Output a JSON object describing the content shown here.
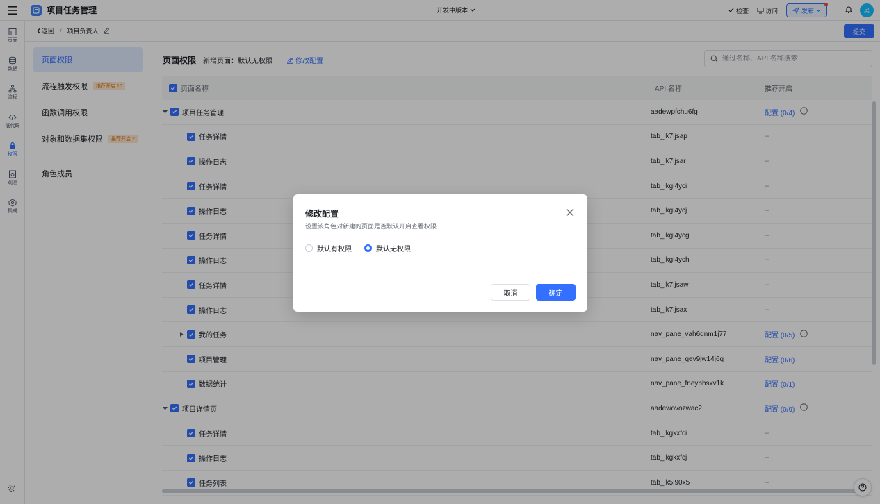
{
  "app": {
    "title": "项目任务管理",
    "version": "开发中版本"
  },
  "topbar": {
    "check": "检查",
    "visit": "访问",
    "publish": "发布",
    "avatar": "吴"
  },
  "rail": [
    {
      "label": "页面",
      "icon": "layout-icon"
    },
    {
      "label": "数据",
      "icon": "database-icon"
    },
    {
      "label": "流程",
      "icon": "flow-icon"
    },
    {
      "label": "低代码",
      "icon": "code-icon"
    },
    {
      "label": "权限",
      "icon": "lock-icon",
      "active": true
    },
    {
      "label": "观测",
      "icon": "monitor-icon"
    },
    {
      "label": "集成",
      "icon": "integration-icon"
    }
  ],
  "breadcrumb": {
    "back": "返回",
    "current": "项目负责人",
    "submit": "提交"
  },
  "sidebar": {
    "items": [
      {
        "label": "页面权限",
        "badge": ""
      },
      {
        "label": "流程触发权限",
        "badge": "推荐开启 10"
      },
      {
        "label": "函数调用权限",
        "badge": ""
      },
      {
        "label": "对象和数据集权限",
        "badge": "推荐开启 2"
      }
    ],
    "members": "角色成员"
  },
  "main": {
    "title": "页面权限",
    "subtitle": "新增页面：默认无权限",
    "modify": "修改配置",
    "search_placeholder": "通过名称、API 名称搜索"
  },
  "table": {
    "headers": {
      "name": "页面名称",
      "api": "API 名称",
      "recommend": "推荐开启"
    },
    "rows": [
      {
        "name": "项目任务管理",
        "api": "aadewpfchu6fg",
        "rec": "配置 (0/4)",
        "level": 0,
        "caret": "down",
        "info": true
      },
      {
        "name": "任务详情",
        "api": "tab_lk7ljsap",
        "rec": "--",
        "level": 1
      },
      {
        "name": "操作日志",
        "api": "tab_lk7ljsar",
        "rec": "--",
        "level": 1
      },
      {
        "name": "任务详情",
        "api": "tab_lkgl4yci",
        "rec": "--",
        "level": 1
      },
      {
        "name": "操作日志",
        "api": "tab_lkgl4ycj",
        "rec": "--",
        "level": 1
      },
      {
        "name": "任务详情",
        "api": "tab_lkgl4ycg",
        "rec": "--",
        "level": 1
      },
      {
        "name": "操作日志",
        "api": "tab_lkgl4ych",
        "rec": "--",
        "level": 1
      },
      {
        "name": "任务详情",
        "api": "tab_lk7ljsaw",
        "rec": "--",
        "level": 1
      },
      {
        "name": "操作日志",
        "api": "tab_lk7ljsax",
        "rec": "--",
        "level": 1
      },
      {
        "name": "我的任务",
        "api": "nav_pane_vah6dnm1j77",
        "rec": "配置 (0/5)",
        "level": 1,
        "caret": "right",
        "info": true
      },
      {
        "name": "项目管理",
        "api": "nav_pane_qev9jw14j6q",
        "rec": "配置 (0/6)",
        "level": 1
      },
      {
        "name": "数据统计",
        "api": "nav_pane_fneybhsxv1k",
        "rec": "配置 (0/1)",
        "level": 1
      },
      {
        "name": "项目详情页",
        "api": "aadewovozwac2",
        "rec": "配置 (0/9)",
        "level": 0,
        "caret": "down",
        "info": true
      },
      {
        "name": "任务详情",
        "api": "tab_lkgkxfci",
        "rec": "--",
        "level": 1
      },
      {
        "name": "操作日志",
        "api": "tab_lkgkxfcj",
        "rec": "--",
        "level": 1
      },
      {
        "name": "任务列表",
        "api": "tab_lk5i90x5",
        "rec": "--",
        "level": 1
      }
    ]
  },
  "dialog": {
    "title": "修改配置",
    "description": "设置该角色对新建的页面是否默认开启查看权限",
    "options": [
      {
        "label": "默认有权限",
        "checked": false
      },
      {
        "label": "默认无权限",
        "checked": true
      }
    ],
    "cancel": "取消",
    "ok": "确定"
  }
}
